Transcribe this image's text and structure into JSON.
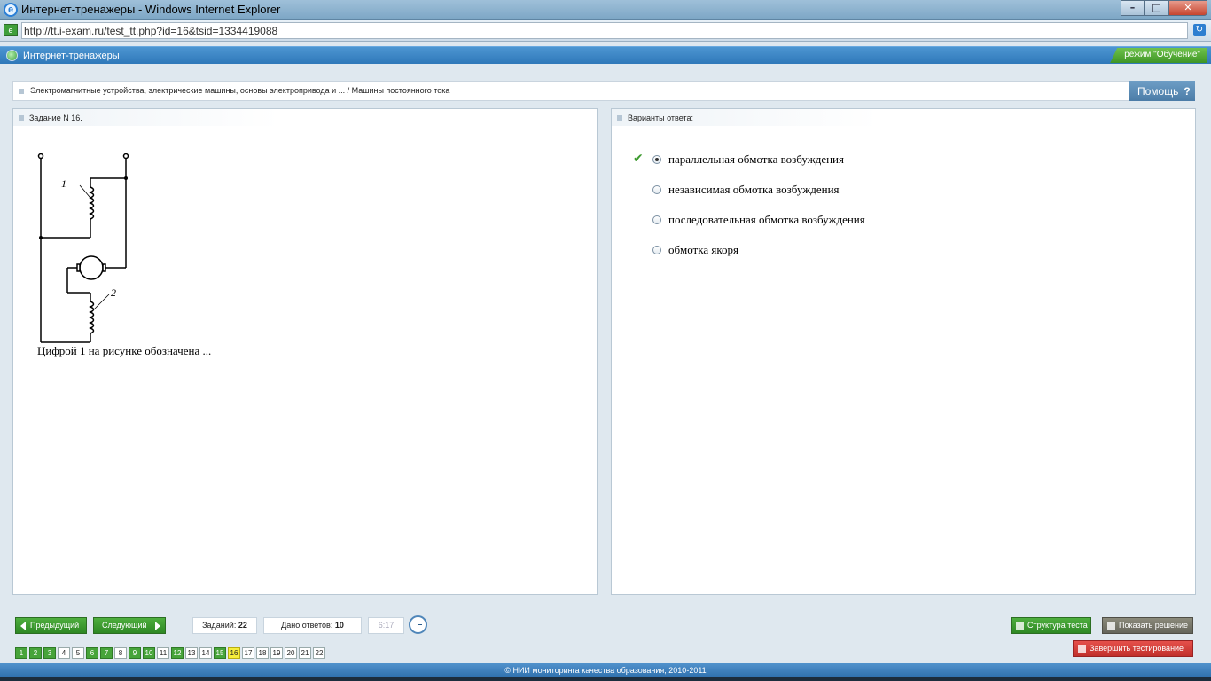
{
  "window": {
    "title": "Интернет-тренажеры - Windows Internet Explorer",
    "url": "http://tt.i-exam.ru/test_tt.php?id=16&tsid=1334419088"
  },
  "app": {
    "title": "Интернет-тренажеры",
    "mode": "режим \"Обучение\""
  },
  "breadcrumb": "Электромагнитные устройства, электрические машины, основы электропривода и ... / Машины постоянного тока",
  "help_label": "Помощь",
  "question": {
    "header": "Задание N 16.",
    "text": "Цифрой 1 на рисунке обозначена ...",
    "figure_labels": [
      "1",
      "2"
    ]
  },
  "answers": {
    "header": "Варианты ответа:",
    "options": [
      {
        "label": "параллельная обмотка возбуждения",
        "selected": true,
        "correct_mark": true
      },
      {
        "label": "независимая обмотка возбуждения",
        "selected": false,
        "correct_mark": false
      },
      {
        "label": "последовательная обмотка возбуждения",
        "selected": false,
        "correct_mark": false
      },
      {
        "label": "обмотка якоря",
        "selected": false,
        "correct_mark": false
      }
    ]
  },
  "nav": {
    "prev_label": "Предыдущий",
    "next_label": "Следующий",
    "tasks_label": "Заданий:",
    "tasks_value": "22",
    "answered_label": "Дано ответов:",
    "answered_value": "10",
    "timer": "6:17",
    "structure_label": "Структура теста",
    "solution_label": "Показать решение",
    "finish_label": "Завершить тестирование"
  },
  "question_numbers": [
    {
      "n": "1",
      "state": "done"
    },
    {
      "n": "2",
      "state": "done"
    },
    {
      "n": "3",
      "state": "done"
    },
    {
      "n": "4",
      "state": "open"
    },
    {
      "n": "5",
      "state": "open"
    },
    {
      "n": "6",
      "state": "done"
    },
    {
      "n": "7",
      "state": "done"
    },
    {
      "n": "8",
      "state": "open"
    },
    {
      "n": "9",
      "state": "done"
    },
    {
      "n": "10",
      "state": "done"
    },
    {
      "n": "11",
      "state": "open"
    },
    {
      "n": "12",
      "state": "done"
    },
    {
      "n": "13",
      "state": "open"
    },
    {
      "n": "14",
      "state": "open"
    },
    {
      "n": "15",
      "state": "done"
    },
    {
      "n": "16",
      "state": "current"
    },
    {
      "n": "17",
      "state": "open"
    },
    {
      "n": "18",
      "state": "open"
    },
    {
      "n": "19",
      "state": "open"
    },
    {
      "n": "20",
      "state": "open"
    },
    {
      "n": "21",
      "state": "open"
    },
    {
      "n": "22",
      "state": "open"
    }
  ],
  "footer": "© НИИ мониторинга качества образования, 2010-2011",
  "colors": {
    "accent": "#2f78b9",
    "done": "#47a43a",
    "current": "#f6ee3b",
    "finish": "#c0302b"
  }
}
